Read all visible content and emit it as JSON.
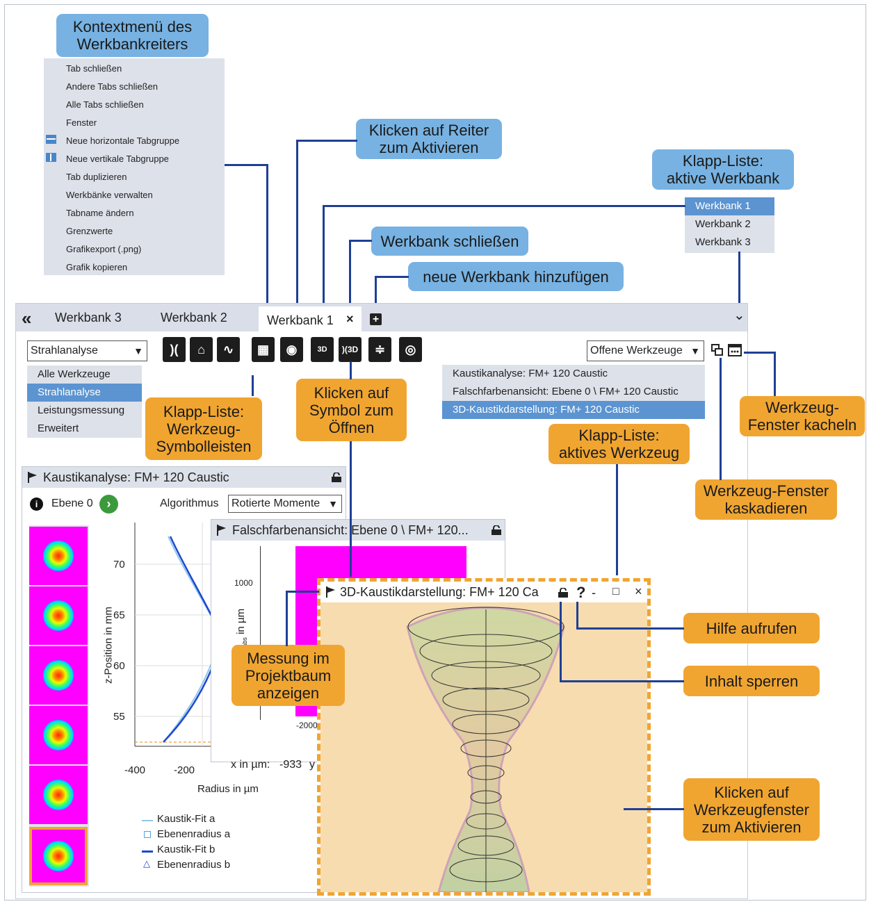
{
  "callouts": {
    "context_menu": "Kontextmenü des\nWerkbankreiters",
    "click_tab": "Klicken auf Reiter\nzum Aktivieren",
    "active_workbench_list": "Klapp-Liste:\naktive Werkbank",
    "close_workbench": "Werkbank schließen",
    "add_workbench": "neue Werkbank hinzufügen",
    "toolbar_list": "Klapp-Liste:\nWerkzeug-\nSymbolleisten",
    "click_symbol": "Klicken auf\nSymbol zum\nÖffnen",
    "active_tool_list": "Klapp-Liste:\naktives Werkzeug",
    "tile_windows": "Werkzeug-\nFenster kacheln",
    "cascade_windows": "Werkzeug-Fenster\nkaskadieren",
    "show_in_tree": "Messung im\nProjektbaum\nanzeigen",
    "help": "Hilfe aufrufen",
    "lock_content": "Inhalt sperren",
    "click_window": "Klicken auf\nWerkzeugfenster\nzum Aktivieren"
  },
  "context_menu": [
    "Tab schließen",
    "Andere Tabs schließen",
    "Alle Tabs schließen",
    "Fenster",
    "Neue horizontale Tabgruppe",
    "Neue vertikale Tabgruppe",
    "Tab duplizieren",
    "Werkbänke verwalten",
    "Tabname ändern",
    "Grenzwerte",
    "Grafikexport (.png)",
    "Grafik kopieren"
  ],
  "workbench_list": [
    "Werkbank 1",
    "Werkbank 2",
    "Werkbank 3"
  ],
  "tabs": {
    "collapse_glyph": "«",
    "tab3": "Werkbank 3",
    "tab2": "Werkbank 2",
    "tab1": "Werkbank 1",
    "close": "×",
    "add": "+",
    "chevron": "⌄"
  },
  "toolbar_select": "Strahlanalyse",
  "toolbar_options": [
    "Alle Werkzeuge",
    "Strahlanalyse",
    "Leistungsmessung",
    "Erweitert"
  ],
  "open_tools_select": "Offene Werkzeuge",
  "open_tools": [
    "Kaustikanalyse: FM+ 120 Caustic",
    "Falschfarbenansicht: Ebene 0 \\ FM+ 120 Caustic",
    "3D-Kaustikdarstellung: FM+ 120 Caustic"
  ],
  "toolbar_icons": [
    "caustic-icon",
    "beam-profile-icon",
    "curve-icon",
    "table-icon",
    "spot-icon",
    "3d-icon",
    "caustic-3d-icon",
    "stack-icon",
    "rings-icon"
  ],
  "caustic_window": {
    "title": "Kaustikanalyse: FM+ 120 Caustic",
    "plane_label": "Ebene 0",
    "algorithm_label": "Algorithmus",
    "algorithm_value": "Rotierte Momente",
    "ylabel": "z-Position in mm",
    "xlabel": "Radius in µm",
    "yticks": [
      "70",
      "65",
      "60",
      "55"
    ],
    "xticks": [
      "-400",
      "-200"
    ],
    "legend": [
      "Kaustik-Fit a",
      "Ebenenradius a",
      "Kaustik-Fit b",
      "Ebenenradius b"
    ]
  },
  "falsecolor_window": {
    "title": "Falschfarbenansicht: Ebene 0 \\ FM+ 120...",
    "ytick_1000": "1000",
    "ytick_m2000": "-2000",
    "ylabel_main": "y",
    "ylabel_sub": "abs",
    "ylabel_unit": " in µm",
    "x_readout_label": "x in µm:",
    "x_readout_value": "-933",
    "y_readout_label": "y"
  },
  "window3d": {
    "title": "3D-Kaustikdarstellung: FM+ 120 Ca",
    "help": "?",
    "minimize": "-",
    "maximize": "□",
    "close": "×"
  },
  "colors": {
    "blue_callout": "#77b2e2",
    "orange_callout": "#f0a531",
    "leader": "#1f3f95",
    "selection": "#5b94d1"
  }
}
